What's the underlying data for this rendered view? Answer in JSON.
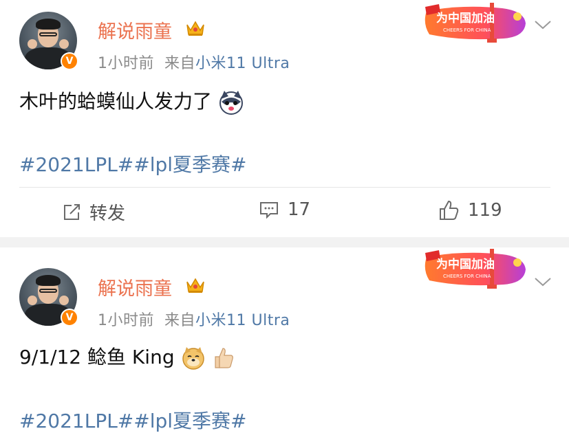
{
  "posts": [
    {
      "author": "解说雨童",
      "time": "1小时前",
      "source_prefix": "来自",
      "source": "小米11 Ultra",
      "text": "木叶的蛤蟆仙人发力了",
      "emoji": "husky-emoji",
      "hashtags": "#2021LPL##lpl夏季赛#",
      "badge_text": "为中国加油",
      "badge_subtext": "CHEERS FOR CHINA",
      "actions": {
        "repost": "转发",
        "comments": "17",
        "likes": "119"
      }
    },
    {
      "author": "解说雨童",
      "time": "1小时前",
      "source_prefix": "来自",
      "source": "小米11 Ultra",
      "text": "9/1/12 鲶鱼 King",
      "emoji": "doge-emoji thumbs-up-emoji",
      "hashtags": "#2021LPL##lpl夏季赛#",
      "badge_text": "为中国加油",
      "badge_subtext": "CHEERS FOR CHINA"
    }
  ],
  "colors": {
    "username": "#eb7350",
    "link": "#4f78a6",
    "meta": "#8a8a8a",
    "verify": "#ff8200"
  }
}
